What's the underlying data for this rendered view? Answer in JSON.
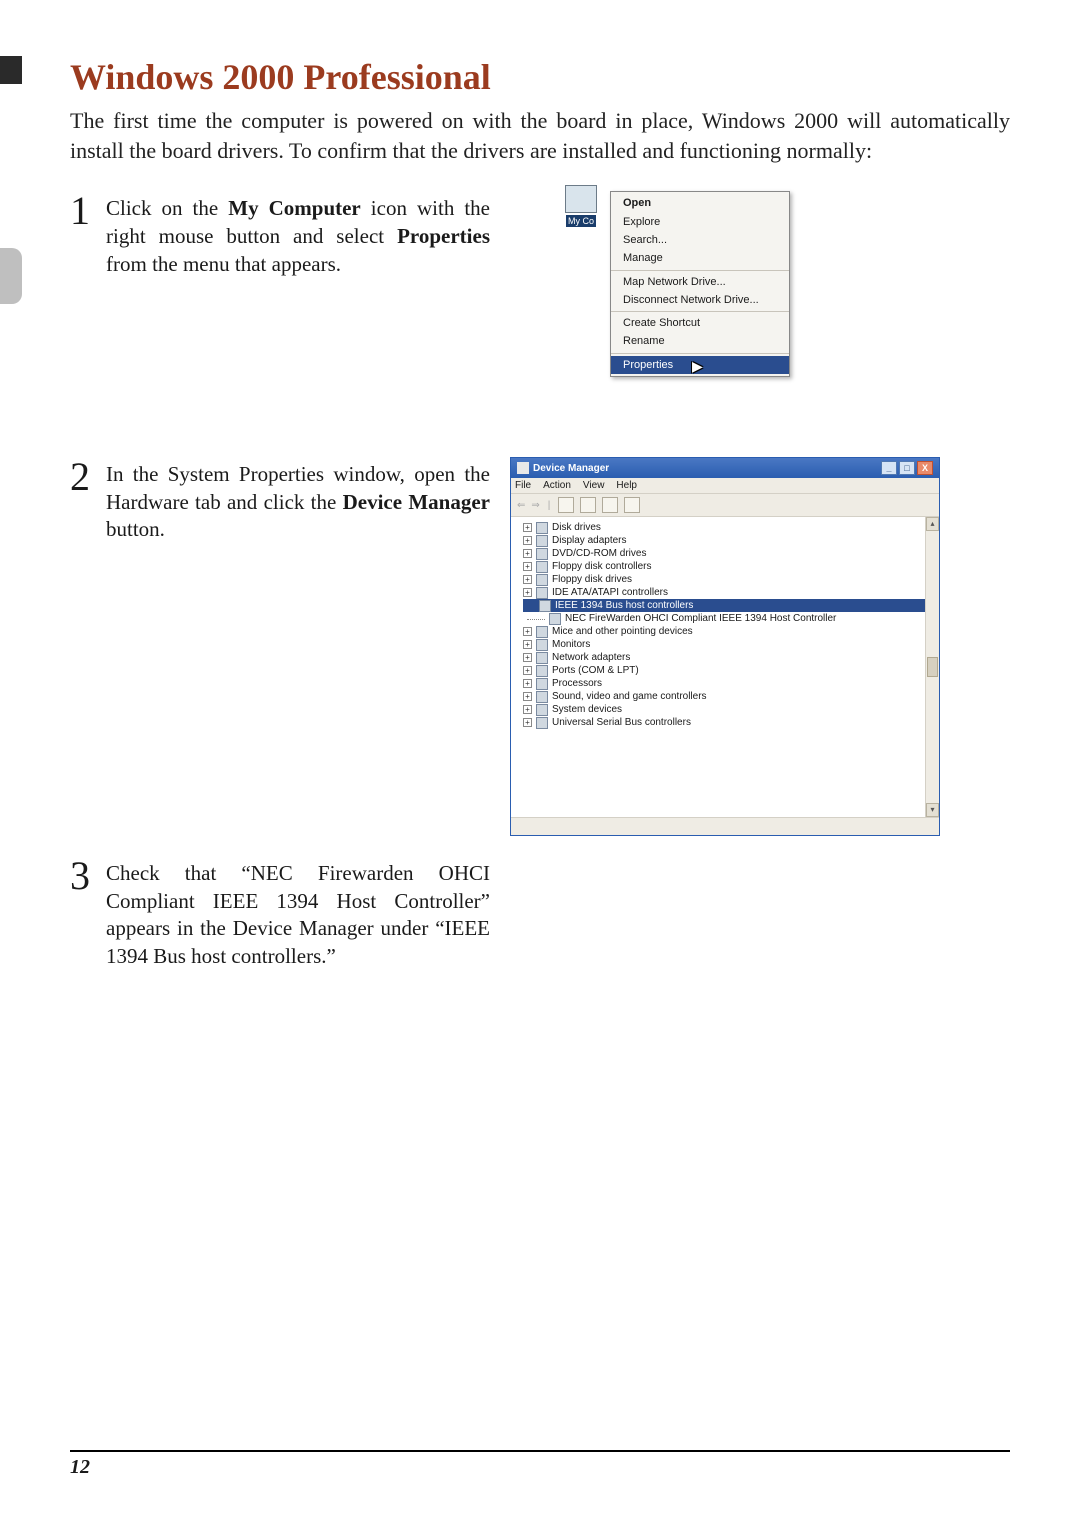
{
  "title": "Windows 2000 Professional",
  "intro": "The first time the computer is powered on with the board in place, Windows 2000 will automatically install the board drivers.  To confirm that the drivers are installed and functioning normally:",
  "steps": {
    "s1": {
      "num": "1",
      "pre": "Click on the ",
      "bold1": "My Computer",
      "mid": " icon with the right mouse button and select ",
      "bold2": "Properties",
      "post": " from the menu that appears."
    },
    "s2": {
      "num": "2",
      "pre": "In the System Properties window, open the Hardware tab and click the ",
      "bold1": "Device Manager",
      "post": " button."
    },
    "s3": {
      "num": "3",
      "text": "Check that “NEC Firewarden OHCI Compliant IEEE 1394 Host Controller” appears in the Device Manager under “IEEE 1394 Bus host controllers.”"
    }
  },
  "context_menu": {
    "icon_label": "My Co",
    "groups": [
      [
        "Open",
        "Explore",
        "Search...",
        "Manage"
      ],
      [
        "Map Network Drive...",
        "Disconnect Network Drive..."
      ],
      [
        "Create Shortcut",
        "Rename"
      ],
      [
        "Properties"
      ]
    ],
    "bold_item": "Open",
    "selected_item": "Properties"
  },
  "device_manager": {
    "title": "Device Manager",
    "menu": [
      "File",
      "Action",
      "View",
      "Help"
    ],
    "tree": [
      {
        "exp": "+",
        "label": "Disk drives"
      },
      {
        "exp": "+",
        "label": "Display adapters"
      },
      {
        "exp": "+",
        "label": "DVD/CD-ROM drives"
      },
      {
        "exp": "+",
        "label": "Floppy disk controllers"
      },
      {
        "exp": "+",
        "label": "Floppy disk drives"
      },
      {
        "exp": "+",
        "label": "IDE ATA/ATAPI controllers"
      }
    ],
    "selected_header": "IEEE 1394 Bus host controllers",
    "selected_child": "NEC FireWarden OHCI Compliant IEEE 1394 Host Controller",
    "tree2": [
      {
        "exp": "+",
        "label": "Mice and other pointing devices"
      },
      {
        "exp": "+",
        "label": "Monitors"
      },
      {
        "exp": "+",
        "label": "Network adapters"
      },
      {
        "exp": "+",
        "label": "Ports (COM & LPT)"
      },
      {
        "exp": "+",
        "label": "Processors"
      },
      {
        "exp": "+",
        "label": "Sound, video and game controllers"
      },
      {
        "exp": "+",
        "label": "System devices"
      },
      {
        "exp": "+",
        "label": "Universal Serial Bus controllers"
      }
    ],
    "win_buttons": {
      "min": "_",
      "max": "□",
      "close": "X"
    }
  },
  "page_number": "12"
}
